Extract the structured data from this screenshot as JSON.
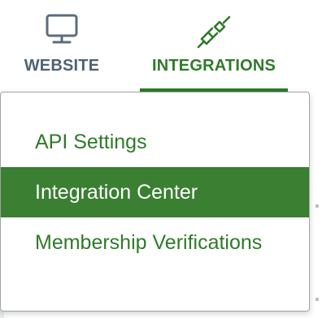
{
  "nav": {
    "tabs": [
      {
        "label": "WEBSITE",
        "icon": "monitor-icon",
        "active": false
      },
      {
        "label": "INTEGRATIONS",
        "icon": "plug-icon",
        "active": true
      }
    ]
  },
  "dropdown": {
    "items": [
      {
        "label": "API Settings",
        "active": false
      },
      {
        "label": "Integration Center",
        "active": true
      },
      {
        "label": "Membership Verifications",
        "active": false
      }
    ]
  },
  "colors": {
    "accent": "#2f7a2a",
    "active_row": "#3b7f32",
    "inactive_tab": "#4f6172"
  }
}
